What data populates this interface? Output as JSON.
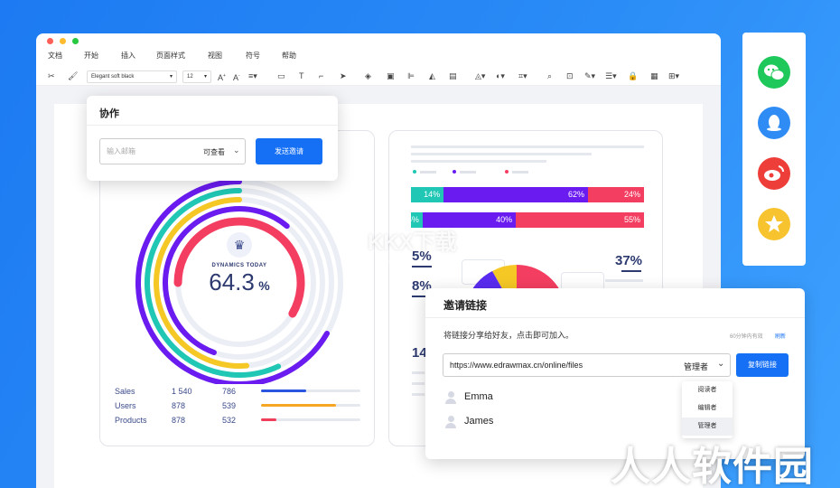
{
  "menu": [
    "文档",
    "开始",
    "插入",
    "页面样式",
    "视图",
    "符号",
    "帮助"
  ],
  "toolbar": {
    "font_name": "Elegant soft black",
    "font_size": "12"
  },
  "collab": {
    "title": "协作",
    "email_placeholder": "输入邮箱",
    "permission": "可查看",
    "send_button": "发送邀请"
  },
  "gauge": {
    "label": "DYNAMICS TODAY",
    "value": "64.3",
    "unit": "%"
  },
  "stats": [
    {
      "name": "Sales",
      "v1": "1 540",
      "v2": "786",
      "fill": 0.45,
      "color": "#2a55e0"
    },
    {
      "name": "Users",
      "v1": "878",
      "v2": "539",
      "fill": 0.75,
      "color": "#f5a623"
    },
    {
      "name": "Products",
      "v1": "878",
      "v2": "532",
      "fill": 0.15,
      "color": "#f03e5a"
    }
  ],
  "bars": [
    {
      "segments": [
        {
          "label": "14%",
          "value": 14,
          "color": "#1fc7b4"
        },
        {
          "label": "62%",
          "value": 62,
          "color": "#6a1bf0"
        },
        {
          "label": "24%",
          "value": 24,
          "color": "#f43e61"
        }
      ]
    },
    {
      "segments": [
        {
          "label": "5%",
          "value": 5,
          "color": "#1fc7b4"
        },
        {
          "label": "40%",
          "value": 40,
          "color": "#6a1bf0"
        },
        {
          "label": "55%",
          "value": 55,
          "color": "#f43e61"
        }
      ]
    }
  ],
  "right_card": {
    "pct_a": "5%",
    "pct_b": "8%",
    "pct_c": "37%",
    "num": "14"
  },
  "invite": {
    "title": "邀请链接",
    "desc": "将链接分享给好友，点击即可加入。",
    "expiry": "60分钟内有效",
    "refresh": "刷新",
    "url": "https://www.edrawmax.cn/online/files",
    "role": "管理者",
    "copy_button": "复制链接",
    "users": [
      "Emma",
      "James"
    ],
    "role_options": [
      "阅读者",
      "编辑者",
      "管理者"
    ]
  },
  "watermark": {
    "center": "KKX下载",
    "center_sub": "www.kkx.net",
    "corner": "人人软件园"
  },
  "colors": {
    "accent": "#1570f5",
    "teal": "#1fc7b4",
    "purple": "#6a1bf0",
    "red": "#f43e61",
    "yellow": "#f5c825"
  },
  "icons": [
    "scissors-icon",
    "format-painter-icon",
    "wechat-icon",
    "qq-icon",
    "weibo-icon",
    "qzone-star-icon"
  ]
}
